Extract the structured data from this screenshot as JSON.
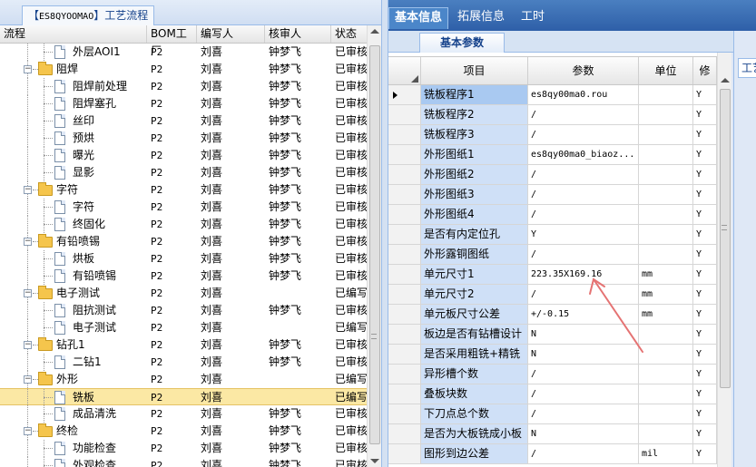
{
  "left_panel": {
    "tab_prefix": "【",
    "tab_code": "ES8QYOOMAO",
    "tab_suffix": "】工艺流程",
    "columns": [
      "流程",
      "BOM工厂",
      "编写人",
      "核审人",
      "状态"
    ],
    "rows": [
      {
        "level": 2,
        "type": "doc",
        "name": "外层AOI1",
        "bom": "P2",
        "author": "刘喜",
        "reviewer": "钟梦飞",
        "status": "已审核"
      },
      {
        "level": 1,
        "type": "folder",
        "name": "阻焊",
        "bom": "P2",
        "author": "刘喜",
        "reviewer": "钟梦飞",
        "status": "已审核"
      },
      {
        "level": 2,
        "type": "doc",
        "name": "阻焊前处理",
        "bom": "P2",
        "author": "刘喜",
        "reviewer": "钟梦飞",
        "status": "已审核"
      },
      {
        "level": 2,
        "type": "doc",
        "name": "阻焊塞孔",
        "bom": "P2",
        "author": "刘喜",
        "reviewer": "钟梦飞",
        "status": "已审核"
      },
      {
        "level": 2,
        "type": "doc",
        "name": "丝印",
        "bom": "P2",
        "author": "刘喜",
        "reviewer": "钟梦飞",
        "status": "已审核"
      },
      {
        "level": 2,
        "type": "doc",
        "name": "预烘",
        "bom": "P2",
        "author": "刘喜",
        "reviewer": "钟梦飞",
        "status": "已审核"
      },
      {
        "level": 2,
        "type": "doc",
        "name": "曝光",
        "bom": "P2",
        "author": "刘喜",
        "reviewer": "钟梦飞",
        "status": "已审核"
      },
      {
        "level": 2,
        "type": "doc",
        "name": "显影",
        "bom": "P2",
        "author": "刘喜",
        "reviewer": "钟梦飞",
        "status": "已审核"
      },
      {
        "level": 1,
        "type": "folder",
        "name": "字符",
        "bom": "P2",
        "author": "刘喜",
        "reviewer": "钟梦飞",
        "status": "已审核"
      },
      {
        "level": 2,
        "type": "doc",
        "name": "字符",
        "bom": "P2",
        "author": "刘喜",
        "reviewer": "钟梦飞",
        "status": "已审核"
      },
      {
        "level": 2,
        "type": "doc",
        "name": "终固化",
        "bom": "P2",
        "author": "刘喜",
        "reviewer": "钟梦飞",
        "status": "已审核"
      },
      {
        "level": 1,
        "type": "folder",
        "name": "有铅喷锡",
        "bom": "P2",
        "author": "刘喜",
        "reviewer": "钟梦飞",
        "status": "已审核"
      },
      {
        "level": 2,
        "type": "doc",
        "name": "烘板",
        "bom": "P2",
        "author": "刘喜",
        "reviewer": "钟梦飞",
        "status": "已审核"
      },
      {
        "level": 2,
        "type": "doc",
        "name": "有铅喷锡",
        "bom": "P2",
        "author": "刘喜",
        "reviewer": "钟梦飞",
        "status": "已审核"
      },
      {
        "level": 1,
        "type": "folder",
        "name": "电子测试",
        "bom": "P2",
        "author": "刘喜",
        "reviewer": "",
        "status": "已编写"
      },
      {
        "level": 2,
        "type": "doc",
        "name": "阻抗测试",
        "bom": "P2",
        "author": "刘喜",
        "reviewer": "钟梦飞",
        "status": "已审核"
      },
      {
        "level": 2,
        "type": "doc",
        "name": "电子测试",
        "bom": "P2",
        "author": "刘喜",
        "reviewer": "",
        "status": "已编写"
      },
      {
        "level": 1,
        "type": "folder",
        "name": "钻孔1",
        "bom": "P2",
        "author": "刘喜",
        "reviewer": "钟梦飞",
        "status": "已审核"
      },
      {
        "level": 2,
        "type": "doc",
        "name": "二钻1",
        "bom": "P2",
        "author": "刘喜",
        "reviewer": "钟梦飞",
        "status": "已审核"
      },
      {
        "level": 1,
        "type": "folder",
        "name": "外形",
        "bom": "P2",
        "author": "刘喜",
        "reviewer": "",
        "status": "已编写"
      },
      {
        "level": 2,
        "type": "doc",
        "name": "铣板",
        "bom": "P2",
        "author": "刘喜",
        "reviewer": "",
        "status": "已编写",
        "selected": true
      },
      {
        "level": 2,
        "type": "doc",
        "name": "成品清洗",
        "bom": "P2",
        "author": "刘喜",
        "reviewer": "钟梦飞",
        "status": "已审核"
      },
      {
        "level": 1,
        "type": "folder",
        "name": "终检",
        "bom": "P2",
        "author": "刘喜",
        "reviewer": "钟梦飞",
        "status": "已审核"
      },
      {
        "level": 2,
        "type": "doc",
        "name": "功能检查",
        "bom": "P2",
        "author": "刘喜",
        "reviewer": "钟梦飞",
        "status": "已审核"
      },
      {
        "level": 2,
        "type": "doc",
        "name": "外观检查",
        "bom": "P2",
        "author": "刘喜",
        "reviewer": "钟梦飞",
        "status": "已审核"
      }
    ]
  },
  "right_panel": {
    "tabs": [
      "基本信息",
      "拓展信息",
      "工时"
    ],
    "subtab": "基本参数",
    "far_tab": "工艺",
    "columns": [
      "项目",
      "参数",
      "单位",
      "修"
    ],
    "rows": [
      {
        "item": "铣板程序1",
        "param": "es8qy00ma0.rou",
        "unit": "",
        "mod": "Y"
      },
      {
        "item": "铣板程序2",
        "param": "/",
        "unit": "",
        "mod": "Y"
      },
      {
        "item": "铣板程序3",
        "param": "/",
        "unit": "",
        "mod": "Y"
      },
      {
        "item": "外形图纸1",
        "param": "es8qy00ma0_biaoz...",
        "unit": "",
        "mod": "Y"
      },
      {
        "item": "外形图纸2",
        "param": "/",
        "unit": "",
        "mod": "Y"
      },
      {
        "item": "外形图纸3",
        "param": "/",
        "unit": "",
        "mod": "Y"
      },
      {
        "item": "外形图纸4",
        "param": "/",
        "unit": "",
        "mod": "Y"
      },
      {
        "item": "是否有内定位孔",
        "param": "Y",
        "unit": "",
        "mod": "Y"
      },
      {
        "item": "外形露铜图纸",
        "param": "/",
        "unit": "",
        "mod": "Y"
      },
      {
        "item": "单元尺寸1",
        "param": "223.35X169.16",
        "unit": "mm",
        "mod": "Y"
      },
      {
        "item": "单元尺寸2",
        "param": "/",
        "unit": "mm",
        "mod": "Y"
      },
      {
        "item": "单元板尺寸公差",
        "param": "+/-0.15",
        "unit": "mm",
        "mod": "Y"
      },
      {
        "item": "板边是否有钻槽设计",
        "param": "N",
        "unit": "",
        "mod": "Y"
      },
      {
        "item": "是否采用粗铣+精铣",
        "param": "N",
        "unit": "",
        "mod": "Y"
      },
      {
        "item": "异形槽个数",
        "param": "/",
        "unit": "",
        "mod": "Y"
      },
      {
        "item": "叠板块数",
        "param": "/",
        "unit": "",
        "mod": "Y"
      },
      {
        "item": "下刀点总个数",
        "param": "/",
        "unit": "",
        "mod": "Y"
      },
      {
        "item": "是否为大板铣成小板",
        "param": "N",
        "unit": "",
        "mod": "Y"
      },
      {
        "item": "图形到边公差",
        "param": "/",
        "unit": "mil",
        "mod": "Y"
      }
    ]
  },
  "colors": {
    "selection": "#fbe8a4",
    "tab_bar": "#2e5fa8",
    "item_cell": "#cfe0f7",
    "arrow": "#e57373"
  }
}
